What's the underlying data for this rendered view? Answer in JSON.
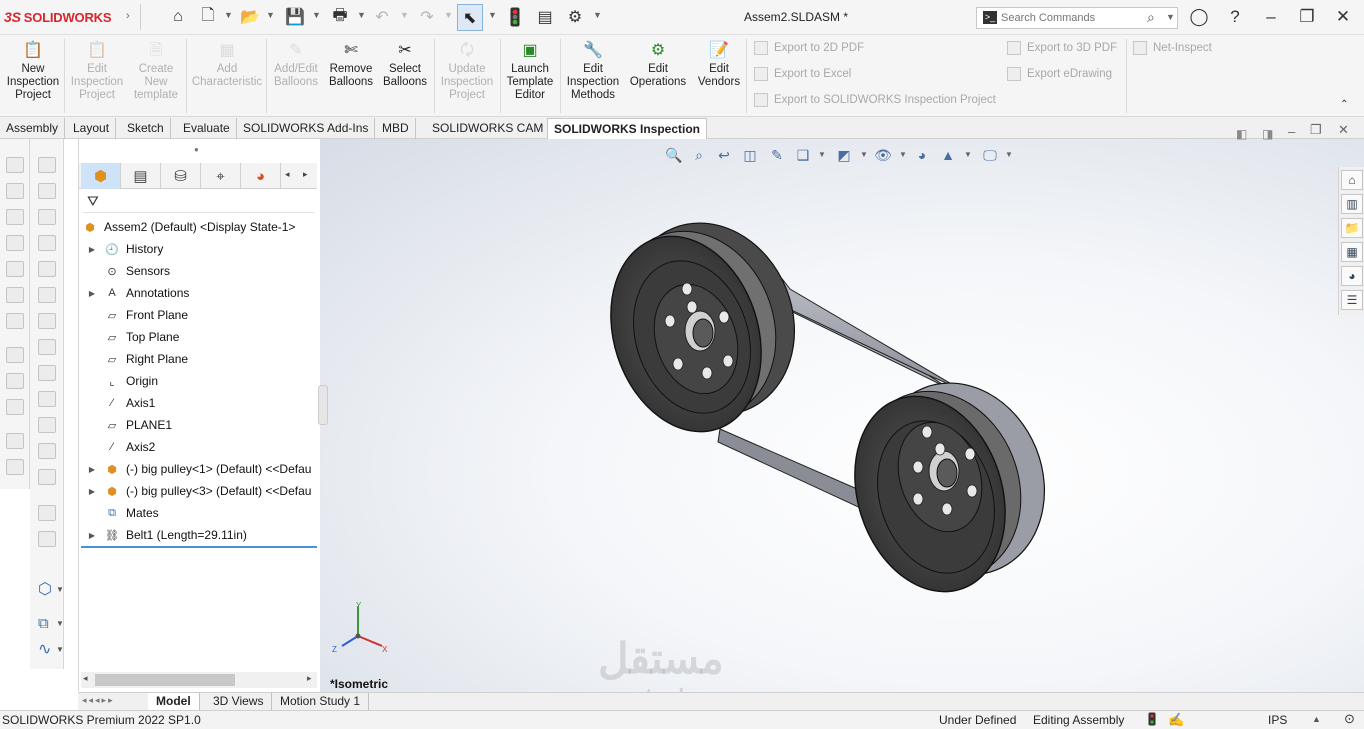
{
  "app": {
    "logo": "SOLIDWORKS",
    "logo_mark": "3S"
  },
  "document_title": "Assem2.SLDASM *",
  "search": {
    "placeholder": "Search Commands"
  },
  "ribbon": {
    "buttons": [
      {
        "label": "New\nInspection\nProject",
        "enabled": true
      },
      {
        "label": "Edit\nInspection\nProject",
        "enabled": false
      },
      {
        "label": "Create\nNew\ntemplate",
        "enabled": false
      },
      {
        "label": "Add\nCharacteristic",
        "enabled": false
      },
      {
        "label": "Add/Edit\nBalloons",
        "enabled": false
      },
      {
        "label": "Remove\nBalloons",
        "enabled": true
      },
      {
        "label": "Select\nBalloons",
        "enabled": true
      },
      {
        "label": "Update\nInspection\nProject",
        "enabled": false
      },
      {
        "label": "Launch\nTemplate\nEditor",
        "enabled": true
      },
      {
        "label": "Edit\nInspection\nMethods",
        "enabled": true
      },
      {
        "label": "Edit\nOperations",
        "enabled": true
      },
      {
        "label": "Edit\nVendors",
        "enabled": true
      }
    ],
    "export_links": [
      "Export to 2D PDF",
      "Export to Excel",
      "Export to SOLIDWORKS Inspection Project",
      "Export to 3D PDF",
      "Export eDrawing",
      "Net-Inspect"
    ]
  },
  "tabs": [
    "Assembly",
    "Layout",
    "Sketch",
    "Evaluate",
    "SOLIDWORKS Add-Ins",
    "MBD",
    "SOLIDWORKS CAM",
    "SOLIDWORKS Inspection"
  ],
  "active_tab": "SOLIDWORKS Inspection",
  "feature_tree": {
    "root": "Assem2 (Default) <Display State-1>",
    "items": [
      {
        "label": "History",
        "expandable": true,
        "icon": "history-icon"
      },
      {
        "label": "Sensors",
        "expandable": false,
        "icon": "sensor-icon"
      },
      {
        "label": "Annotations",
        "expandable": true,
        "icon": "annotation-icon"
      },
      {
        "label": "Front Plane",
        "expandable": false,
        "icon": "plane-icon"
      },
      {
        "label": "Top Plane",
        "expandable": false,
        "icon": "plane-icon"
      },
      {
        "label": "Right Plane",
        "expandable": false,
        "icon": "plane-icon"
      },
      {
        "label": "Origin",
        "expandable": false,
        "icon": "origin-icon"
      },
      {
        "label": "Axis1",
        "expandable": false,
        "icon": "axis-icon"
      },
      {
        "label": "PLANE1",
        "expandable": false,
        "icon": "plane-icon"
      },
      {
        "label": "Axis2",
        "expandable": false,
        "icon": "axis-icon"
      },
      {
        "label": "(-) big pulley<1> (Default) <<Defau",
        "expandable": true,
        "icon": "part-icon"
      },
      {
        "label": "(-) big pulley<3> (Default) <<Defau",
        "expandable": true,
        "icon": "part-icon"
      },
      {
        "label": "Mates",
        "expandable": false,
        "icon": "mates-icon"
      },
      {
        "label": "Belt1 (Length=29.11in)",
        "expandable": true,
        "icon": "belt-icon"
      }
    ]
  },
  "view_label": "*Isometric",
  "triad": {
    "x": "X",
    "y": "Y",
    "z": "Z"
  },
  "bottom_tabs": [
    "Model",
    "3D Views",
    "Motion Study 1"
  ],
  "active_bottom_tab": "Model",
  "status": {
    "product": "SOLIDWORKS Premium 2022 SP1.0",
    "state": "Under Defined",
    "mode": "Editing Assembly",
    "units": "IPS"
  },
  "watermark": {
    "arabic": "مستقل",
    "latin": "mostaql.com"
  },
  "colors": {
    "accent": "#4a90d9",
    "brand": "#d8262e",
    "model": "#3d3d3d"
  }
}
